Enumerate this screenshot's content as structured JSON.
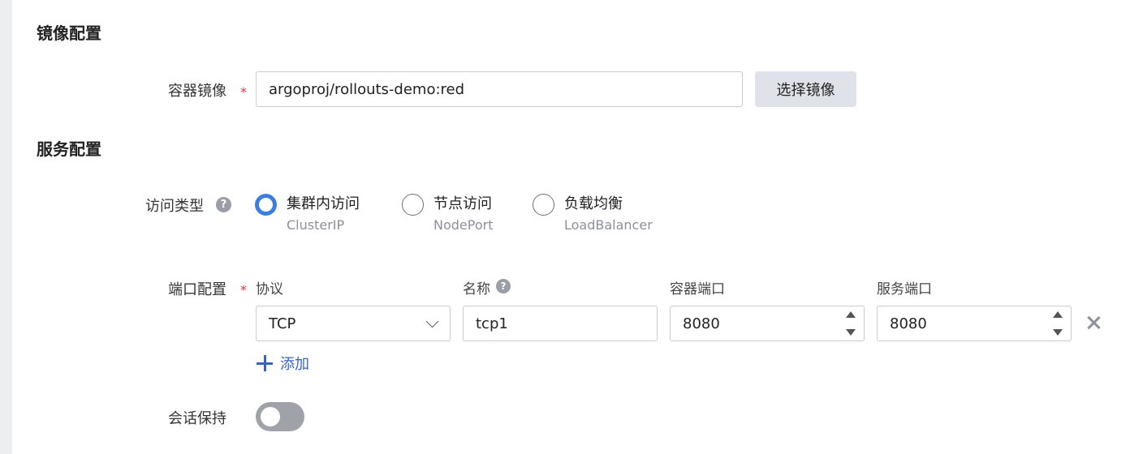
{
  "image_section": {
    "title": "镜像配置",
    "container_image_label": "容器镜像",
    "required_mark": "*",
    "container_image_value": "argoproj/rollouts-demo:red",
    "select_image_button": "选择镜像"
  },
  "service_section": {
    "title": "服务配置",
    "access_type_label": "访问类型",
    "help_icon": "?",
    "access_options": [
      {
        "label": "集群内访问",
        "sub": "ClusterIP",
        "selected": true
      },
      {
        "label": "节点访问",
        "sub": "NodePort",
        "selected": false
      },
      {
        "label": "负载均衡",
        "sub": "LoadBalancer",
        "selected": false
      }
    ],
    "port_config_label": "端口配置",
    "columns": {
      "protocol": "协议",
      "name": "名称",
      "container_port": "容器端口",
      "service_port": "服务端口"
    },
    "port_rows": [
      {
        "protocol": "TCP",
        "name": "tcp1",
        "container_port": "8080",
        "service_port": "8080"
      }
    ],
    "add_label": "添加",
    "session_affinity_label": "会话保持",
    "session_affinity_enabled": false
  },
  "colors": {
    "accent": "#3a7fe0",
    "link": "#3563c4",
    "required": "#d13b3b",
    "toggle_off": "#9fa2a9"
  }
}
